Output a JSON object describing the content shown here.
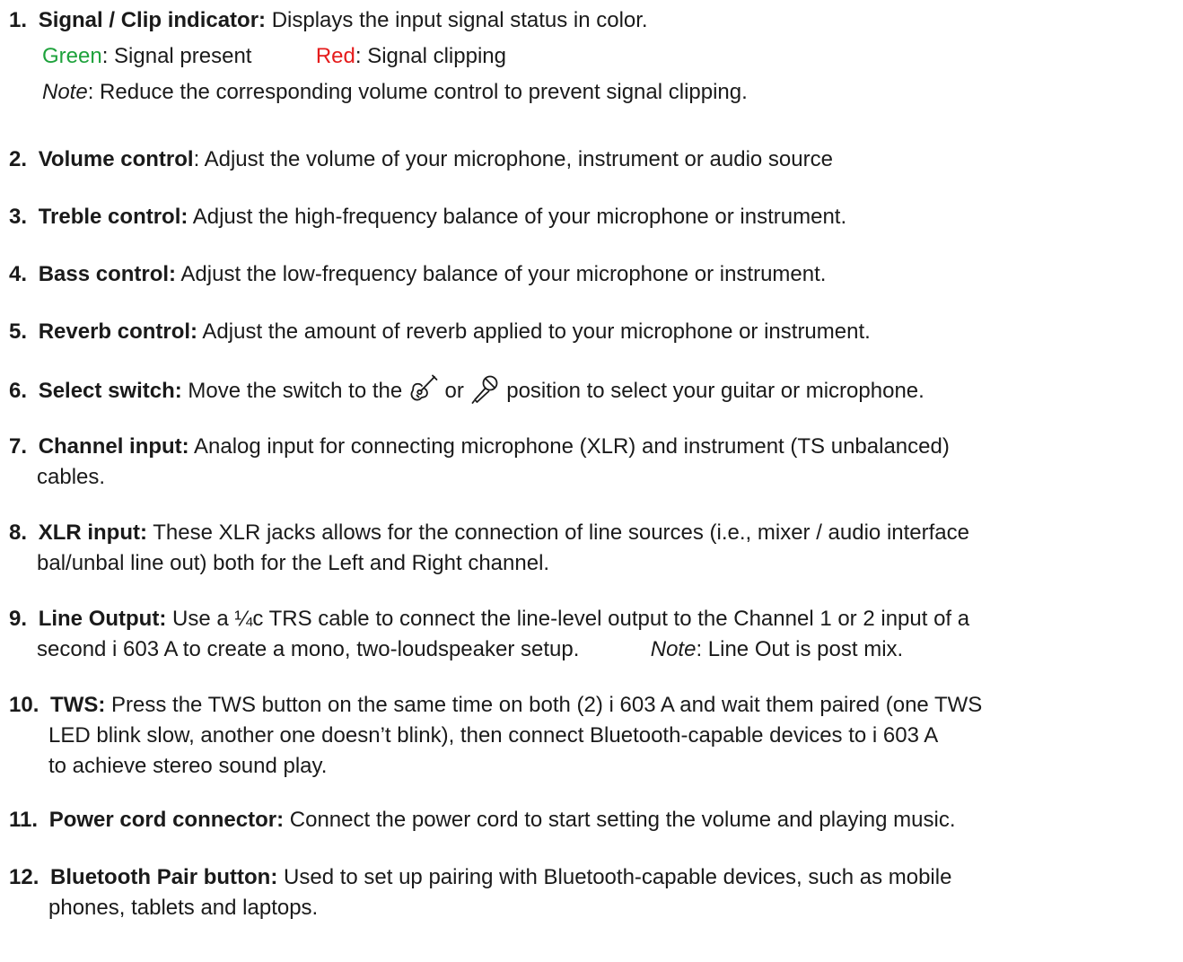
{
  "items": [
    {
      "number": "1.",
      "term": "Signal / Clip indicator:",
      "desc": " Displays the input signal status in color.",
      "green_label": "Green",
      "green_desc": ": Signal present",
      "red_label": "Red",
      "red_desc": ": Signal clipping",
      "note_label": "Note",
      "note_desc": ": Reduce the corresponding volume control to prevent signal clipping."
    },
    {
      "number": "2.",
      "term": "Volume control",
      "desc": ": Adjust the volume of your microphone, instrument or audio source"
    },
    {
      "number": "3.",
      "term": "Treble control:",
      "desc": " Adjust the high-frequency balance of your microphone or instrument."
    },
    {
      "number": "4.",
      "term": "Bass control:",
      "desc": " Adjust the low-frequency balance of your microphone or instrument."
    },
    {
      "number": "5.",
      "term": "Reverb control:",
      "desc": " Adjust the amount of reverb applied to your microphone or instrument."
    },
    {
      "number": "6.",
      "term": "Select switch:",
      "desc_before": " Move the switch to the ",
      "desc_mid": " or ",
      "desc_after": " position to select your guitar or microphone.",
      "icons": [
        "guitar-icon",
        "microphone-icon"
      ]
    },
    {
      "number": "7.",
      "term": "Channel input:",
      "line1": " Analog input for connecting microphone (XLR) and instrument (TS unbalanced)",
      "line2": "cables."
    },
    {
      "number": "8.",
      "term": "XLR input:",
      "line1": " These XLR jacks allows for the connection of line sources (i.e., mixer / audio interface",
      "line2": "bal/unbal line out) both for the Left and Right channel."
    },
    {
      "number": "9.",
      "term": "Line Output:",
      "line1": " Use a ¼c TRS cable to connect the line-level output to the Channel 1 or 2 input of a",
      "line2": "second i 603 A to create a mono, two-loudspeaker setup.",
      "note_label": "Note",
      "note_desc": ": Line Out is post mix."
    },
    {
      "number": "10.",
      "term": "TWS:",
      "line1": " Press the TWS button on the same time on both (2) i 603 A and wait them paired (one TWS",
      "line2": "LED blink slow, another one doesn’t blink), then connect Bluetooth-capable devices to i 603 A",
      "line3": "to achieve stereo sound play."
    },
    {
      "number": "11.",
      "term": "Power cord connector:",
      "desc": " Connect the power cord to start setting the volume and playing music."
    },
    {
      "number": "12.",
      "term": "Bluetooth Pair button:",
      "line1": " Used to set up pairing with Bluetooth-capable devices, such as mobile",
      "line2": "phones, tablets and laptops."
    }
  ],
  "colors": {
    "text": "#1a1a1a",
    "green": "#1ea23c",
    "red": "#e51c1c"
  }
}
